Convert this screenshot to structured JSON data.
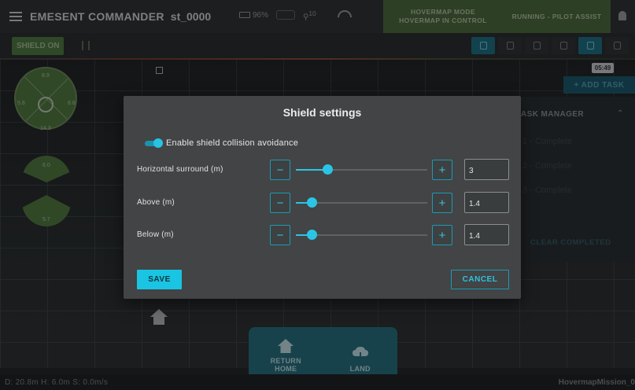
{
  "header": {
    "app_title": "EMESENT COMMANDER",
    "device_id": "st_0000",
    "battery": "96%",
    "sat_count": "10",
    "mode_line1": "HOVERMAP MODE",
    "mode_line2": "HOVERMAP IN CONTROL",
    "run_status": "RUNNING - PILOT ASSIST"
  },
  "toolbar": {
    "shield_label": "SHIELD ON"
  },
  "hud": {
    "top": "8.9",
    "left": "5.8",
    "right": "8.8",
    "bottom": "14.3",
    "up": "6.0",
    "down": "5.7"
  },
  "task_manager": {
    "timer": "05:49",
    "add_task": "+ ADD TASK",
    "title": "ASK MANAGER",
    "items": [
      "1 - Complete",
      "2 - Complete",
      "3 - Complete"
    ],
    "clear": "CLEAR COMPLETED"
  },
  "dock": {
    "return_home": "RETURN HOME",
    "land": "LAND"
  },
  "status": {
    "left": "D: 20.8m  H: 6.0m  S: 0.0m/s",
    "right": "HovermapMission_0"
  },
  "modal": {
    "title": "Shield settings",
    "toggle_label": "Enable shield collision avoidance",
    "toggle_on": true,
    "rows": [
      {
        "label": "Horizontal surround (m)",
        "value": "3",
        "level": 0.24
      },
      {
        "label": "Above (m)",
        "value": "1.4",
        "level": 0.12
      },
      {
        "label": "Below (m)",
        "value": "1.4",
        "level": 0.12
      }
    ],
    "minus": "−",
    "plus": "+",
    "save": "SAVE",
    "cancel": "CANCEL"
  },
  "colors": {
    "accent": "#2cc4e4",
    "mode_green": "#4a6a3a"
  }
}
